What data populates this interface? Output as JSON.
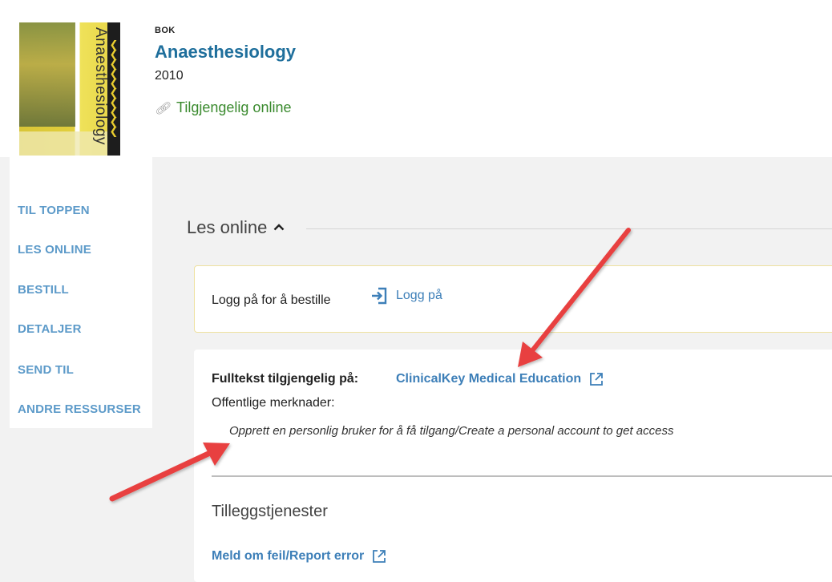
{
  "record": {
    "type_label": "BOK",
    "title": "Anaesthesiology",
    "year": "2010",
    "availability": "Tilgjengelig online",
    "cover_title": "Anaesthesiology"
  },
  "nav": {
    "items": [
      {
        "label": "TIL TOPPEN"
      },
      {
        "label": "LES ONLINE"
      },
      {
        "label": "BESTILL"
      },
      {
        "label": "DETALJER"
      },
      {
        "label": "SEND TIL"
      },
      {
        "label": "ANDRE RESSURSER"
      }
    ]
  },
  "section": {
    "heading": "Les online",
    "caret_icon": "chevron-up-icon"
  },
  "signin": {
    "text": "Logg på for å bestille",
    "link_label": "Logg på",
    "icon": "sign-in-icon"
  },
  "fulltext": {
    "label": "Fulltekst tilgjengelig på:",
    "provider": "ClinicalKey Medical Education",
    "notes_label": "Offentlige merknader:",
    "note": "Opprett en personlig bruker for å få tilgang/Create a personal account to get access"
  },
  "services": {
    "title": "Tilleggstjenester",
    "report_label": "Meld om feil/Report error"
  },
  "colors": {
    "link": "#3d7fb8",
    "title": "#1f6f9c",
    "available": "#3a8a2e",
    "nav": "#5c9ac9",
    "annotation_arrow": "#e8413f"
  }
}
